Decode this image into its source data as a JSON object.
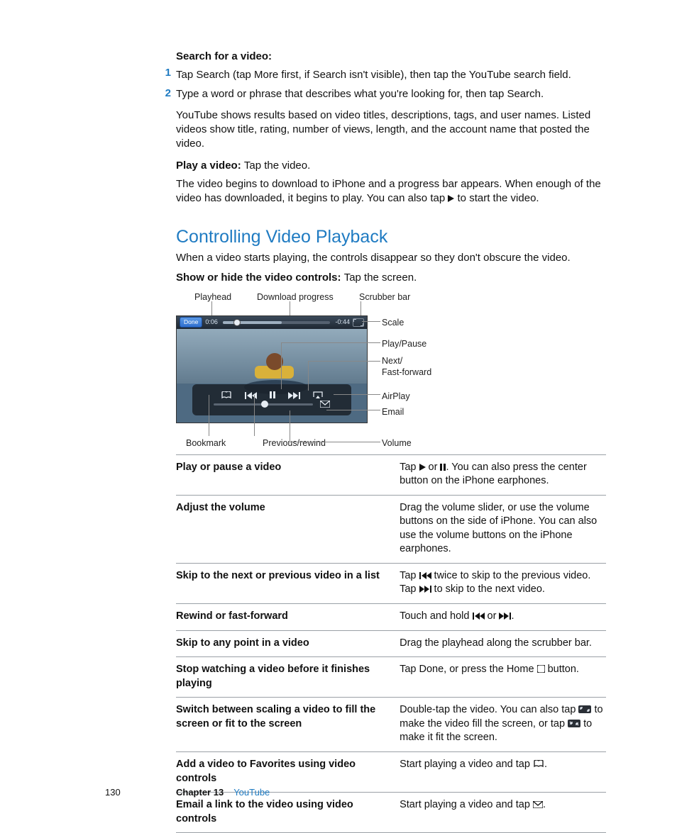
{
  "intro": {
    "search_heading": "Search for a video:",
    "step1_num": "1",
    "step1": "Tap Search (tap More first, if Search isn't visible), then tap the YouTube search field.",
    "step2_num": "2",
    "step2": "Type a word or phrase that describes what you're looking for, then tap Search.",
    "results": "YouTube shows results based on video titles, descriptions, tags, and user names. Listed videos show title, rating, number of views, length, and the account name that posted the video.",
    "play_bold": "Play a video:  ",
    "play_rest": "Tap the video.",
    "download_a": "The video begins to download to iPhone and a progress bar appears. When enough of the video has downloaded, it begins to play. You can also tap ",
    "download_b": " to start the video."
  },
  "section": {
    "title": "Controlling Video Playback",
    "lead": "When a video starts playing, the controls disappear so they don't obscure the video.",
    "show_bold": "Show or hide the video controls:  ",
    "show_rest": "Tap the screen."
  },
  "diagram": {
    "playhead": "Playhead",
    "download_progress": "Download progress",
    "scrubber": "Scrubber bar",
    "scale": "Scale",
    "play_pause": "Play/Pause",
    "next": "Next/\nFast-forward",
    "airplay": "AirPlay",
    "email": "Email",
    "bookmark": "Bookmark",
    "previous": "Previous/rewind",
    "volume": "Volume",
    "done": "Done",
    "t_elapsed": "0:06",
    "t_remain": "-0:44"
  },
  "table": {
    "r0a": "Play or pause a video",
    "r0b1": "Tap ",
    "r0b2": " or ",
    "r0b3": ". You can also press the center button on the iPhone earphones.",
    "r1a": "Adjust the volume",
    "r1b": "Drag the volume slider, or use the volume buttons on the side of iPhone. You can also use the volume buttons on the iPhone earphones.",
    "r2a": "Skip to the next or previous video in a list",
    "r2b1": "Tap ",
    "r2b2": " twice to skip to the previous video. Tap ",
    "r2b3": " to skip to the next video.",
    "r3a": "Rewind or fast-forward",
    "r3b1": "Touch and hold ",
    "r3b2": " or ",
    "r3b3": ".",
    "r4a": "Skip to any point in a video",
    "r4b": "Drag the playhead along the scrubber bar.",
    "r5a": "Stop watching a video before it finishes playing",
    "r5b1": "Tap Done, or press the Home ",
    "r5b2": " button.",
    "r6a": "Switch between scaling a video to fill the screen or fit to the screen",
    "r6b1": "Double-tap the video. You can also tap ",
    "r6b2": " to make the video fill the screen, or tap ",
    "r6b3": " to make it fit the screen.",
    "r7a": "Add a video to Favorites using video controls",
    "r7b1": "Start playing a video and tap ",
    "r7b2": ".",
    "r8a": "Email a link to the video using video controls",
    "r8b1": "Start playing a video and tap ",
    "r8b2": "."
  },
  "footer": {
    "page": "130",
    "chapter": "Chapter 13",
    "name": "YouTube"
  }
}
